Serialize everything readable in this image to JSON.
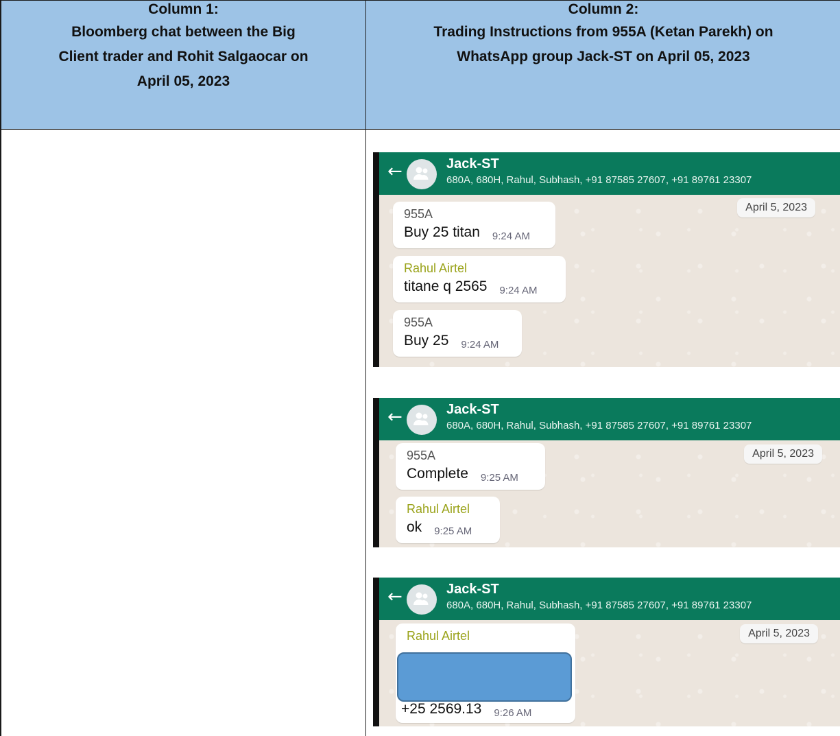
{
  "table": {
    "col1_header": {
      "line1": "Column 1:",
      "line2": "Bloomberg chat between the Big",
      "line3": "Client trader and Rohit Salgaocar on",
      "line4": "April 05, 2023"
    },
    "col2_header": {
      "line1": "Column 2:",
      "line2": "Trading Instructions from 955A (Ketan Parekh) on",
      "line3": "WhatsApp group Jack-ST on April 05, 2023"
    }
  },
  "chat": {
    "group_name": "Jack-ST",
    "members": "680A, 680H, Rahul, Subhash, +91 87585 27607, +91 89761 23307",
    "date": "April 5, 2023",
    "colors": {
      "header": "#0a7a5c",
      "sender_green": "#9aa31a",
      "redaction": "#5b9bd5"
    },
    "panels": [
      {
        "messages": [
          {
            "sender": "955A",
            "text": "Buy 25 titan",
            "time": "9:24 AM"
          },
          {
            "sender": "Rahul Airtel",
            "text": "titane q 2565",
            "time": "9:24 AM"
          },
          {
            "sender": "955A",
            "text": "Buy 25",
            "time": "9:24 AM"
          }
        ]
      },
      {
        "messages": [
          {
            "sender": "955A",
            "text": "Complete",
            "time": "9:25 AM"
          },
          {
            "sender": "Rahul Airtel",
            "text": "ok",
            "time": "9:25 AM"
          }
        ]
      },
      {
        "messages": [
          {
            "sender": "Rahul Airtel",
            "text": "+25 2569.13",
            "time": "9:26 AM",
            "redacted": true
          }
        ]
      }
    ]
  }
}
